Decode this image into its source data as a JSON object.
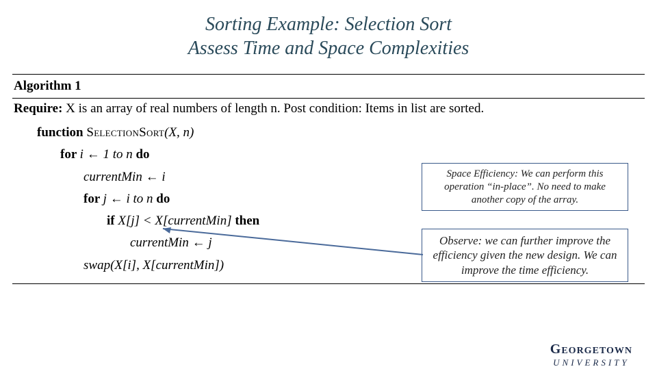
{
  "title_line1": "Sorting Example: Selection Sort",
  "title_line2": "Assess Time and Space Complexities",
  "algo": {
    "heading": "Algorithm 1",
    "require_label": "Require:",
    "require_text": " X is an array of real numbers of length n.  Post condition: Items in list are sorted.",
    "lines": {
      "l1_kw": "function ",
      "l1_name": "SelectionSort",
      "l1_args": "(X, n)",
      "l2_kw1": "for ",
      "l2_expr": "i ← 1 to n",
      "l2_kw2": " do",
      "l3": "currentMin ← i",
      "l4_kw1": "for ",
      "l4_expr": "j ← i to n",
      "l4_kw2": " do",
      "l5_kw1": "if ",
      "l5_expr": "X[j] < X[currentMin]",
      "l5_kw2": " then",
      "l6": "currentMin ← j",
      "l7": "swap(X[i], X[currentMin])"
    }
  },
  "callouts": {
    "space": "Space Efficiency:  We can perform this operation “in-place”. No need to make another copy of the array.",
    "observe": "Observe: we can further improve the efficiency given the new design. We can improve the time efficiency."
  },
  "logo": {
    "name": "Georgetown",
    "sub": "UNIVERSITY"
  }
}
